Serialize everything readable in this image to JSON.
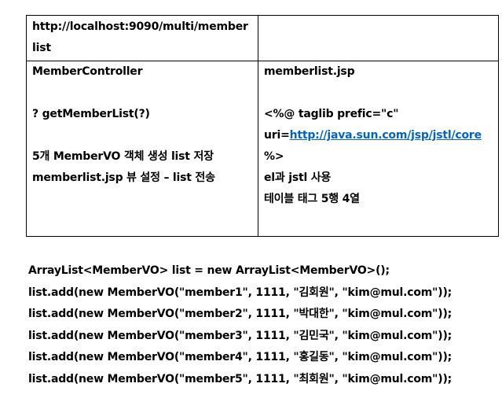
{
  "table": {
    "url": "http://localhost:9090/multi/member",
    "url_wrap": "list",
    "left_cell": {
      "heading": "MemberController",
      "method": "? getMemberList(?)",
      "desc1": "5개   MemberVO 객체 생성 list 저장",
      "desc2": "memberlist.jsp 뷰 설정 – list 전송"
    },
    "right_cell": {
      "heading": "memberlist.jsp",
      "taglib": "<%@ taglib prefic=\"c\"",
      "uri_prefix": "uri=",
      "uri_link": "http://java.sun.com/jsp/jstl/core",
      "close": "%>",
      "note1": "el과 jstl 사용",
      "note2": "테이블 태그 5행 4열"
    }
  },
  "code_lines": [
    "ArrayList<MemberVO> list = new ArrayList<MemberVO>();",
    "list.add(new MemberVO(\"member1\", 1111, \"김회원\", \"kim@mul.com\"));",
    "list.add(new MemberVO(\"member2\", 1111, \"박대한\", \"kim@mul.com\"));",
    "list.add(new MemberVO(\"member3\", 1111, \"김민국\", \"kim@mul.com\"));",
    "list.add(new MemberVO(\"member4\", 1111, \"홍길동\", \"kim@mul.com\"));",
    "list.add(new MemberVO(\"member5\", 1111, \"최회원\", \"kim@mul.com\"));"
  ],
  "colors": {
    "link": "#0563c1",
    "text": "#000000",
    "border": "#000000"
  }
}
